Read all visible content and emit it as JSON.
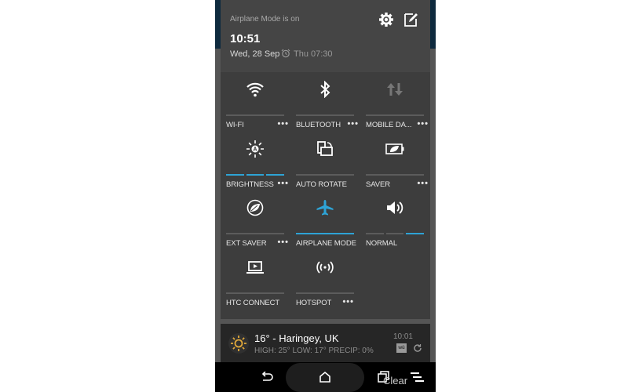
{
  "header": {
    "status": "Airplane Mode is on",
    "time": "10:51",
    "date": "Wed, 28 Sep",
    "alarm": "Thu 07:30",
    "settings_icon": "gear-icon",
    "edit_icon": "edit-icon"
  },
  "tiles": [
    {
      "label": "WI-FI",
      "icon": "wifi-icon",
      "more": "•••",
      "state": "off"
    },
    {
      "label": "BLUETOOTH",
      "icon": "bluetooth-icon",
      "more": "•••",
      "state": "off"
    },
    {
      "label": "MOBILE DA...",
      "icon": "mobile-data-icon",
      "more": "•••",
      "state": "disabled"
    },
    {
      "label": "BRIGHTNESS",
      "icon": "brightness-auto-icon",
      "more": "•••",
      "level": "3/3"
    },
    {
      "label": "AUTO ROTATE",
      "icon": "auto-rotate-icon",
      "state": "off"
    },
    {
      "label": "SAVER",
      "icon": "battery-saver-icon",
      "more": "•••",
      "state": "off"
    },
    {
      "label": "EXT SAVER",
      "icon": "extreme-saver-icon",
      "more": "•••",
      "state": "off"
    },
    {
      "label": "AIRPLANE MODE",
      "icon": "airplane-icon",
      "state": "on"
    },
    {
      "label": "NORMAL",
      "icon": "volume-icon",
      "level": "3/3"
    },
    {
      "label": "HTC CONNECT",
      "icon": "htc-connect-icon",
      "state": "off"
    },
    {
      "label": "HOTSPOT",
      "icon": "hotspot-icon",
      "more": "•••",
      "state": "off"
    }
  ],
  "weather": {
    "title": "16° - Haringey, UK",
    "details": "HIGH: 25° LOW: 17° PRECIP: 0%",
    "updated": "10:01",
    "logo": "wü"
  },
  "navbar": {
    "clear_label": "Clear"
  },
  "colors": {
    "accent": "#2ea3d5",
    "panel": "#3d3d3d",
    "header": "#454545"
  }
}
